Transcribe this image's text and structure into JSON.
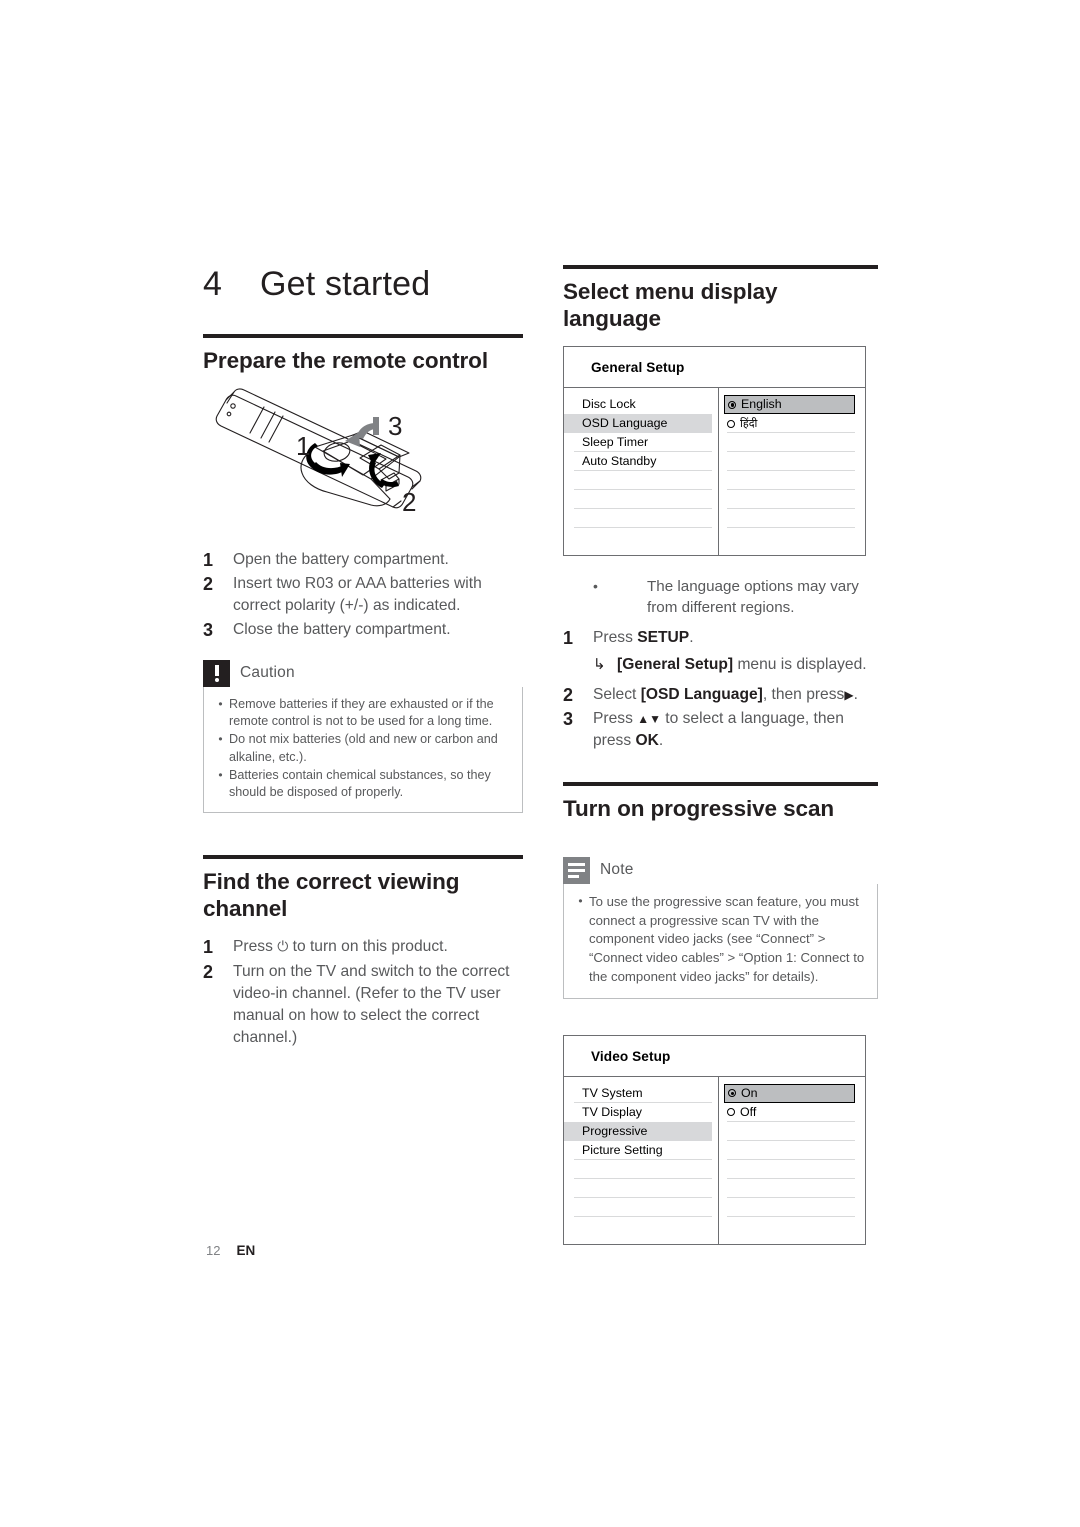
{
  "document": {
    "footer": {
      "page_number": "12",
      "language_code": "EN"
    }
  },
  "chapter": {
    "number": "4",
    "title": "Get started"
  },
  "left_column": {
    "section_remote": {
      "heading": "Prepare the remote control",
      "figure_name": "remote-control-battery-compartment-diagram",
      "figure_callouts": [
        "1",
        "2",
        "3"
      ],
      "steps": [
        {
          "num": "1",
          "text": "Open the battery compartment."
        },
        {
          "num": "2",
          "text": "Insert two R03 or AAA batteries with correct polarity (+/-) as indicated."
        },
        {
          "num": "3",
          "text": "Close the battery compartment."
        }
      ],
      "caution": {
        "title": "Caution",
        "bullets": [
          "Remove batteries if they are exhausted or if the remote control is not to be used for a long time.",
          "Do not mix batteries (old and new or carbon and alkaline, etc.).",
          "Batteries contain chemical substances, so they should be disposed of properly."
        ]
      }
    },
    "section_channel": {
      "heading": "Find the correct viewing channel",
      "steps": [
        {
          "num": "1",
          "text_before": "Press ",
          "symbol": "⏻",
          "text_after": " to turn on this product."
        },
        {
          "num": "2",
          "text": "Turn on the TV and switch to the correct video-in channel. (Refer to the TV user manual on how to select the correct channel.)"
        }
      ]
    }
  },
  "right_column": {
    "section_language": {
      "heading": "Select menu display language",
      "osd": {
        "title": "General Setup",
        "left_items": [
          {
            "label": "Disc Lock",
            "selected": false
          },
          {
            "label": "OSD Language",
            "selected": true
          },
          {
            "label": "Sleep Timer",
            "selected": false
          },
          {
            "label": "Auto Standby",
            "selected": false
          }
        ],
        "right_items": [
          {
            "label": "English",
            "radio": "on",
            "highlighted": true
          },
          {
            "label": "हिंदी",
            "radio": "off",
            "highlighted": false
          }
        ]
      },
      "note_bullets": [
        "The language options may vary from different regions."
      ],
      "steps": [
        {
          "num": "1",
          "text_before": "Press ",
          "bold": "SETUP",
          "text_after": ".",
          "substep": {
            "arrow": "↳",
            "bold": "[General Setup]",
            "text_after": " menu is displayed."
          }
        },
        {
          "num": "2",
          "text_before": "Select ",
          "bold": "[OSD Language]",
          "text_after": ", then press",
          "symbol": "▶",
          "tail": "."
        },
        {
          "num": "3",
          "text_before": "Press ",
          "symbol": "▲▼",
          "text_after": " to select a language, then press ",
          "bold": "OK",
          "tail": "."
        }
      ]
    },
    "section_progressive": {
      "heading": "Turn on progressive scan",
      "note": {
        "title": "Note",
        "bullets": [
          "To use the progressive scan feature, you must connect a progressive scan TV with the component video jacks (see “Connect” > “Connect video cables” > “Option 1: Connect to the component video jacks” for details)."
        ]
      },
      "osd": {
        "title": "Video Setup",
        "left_items": [
          {
            "label": "TV System",
            "selected": false
          },
          {
            "label": "TV Display",
            "selected": false
          },
          {
            "label": "Progressive",
            "selected": true
          },
          {
            "label": "Picture Setting",
            "selected": false
          }
        ],
        "right_items": [
          {
            "label": "On",
            "radio": "on",
            "highlighted": true
          },
          {
            "label": "Off",
            "radio": "off",
            "highlighted": false
          }
        ]
      }
    }
  },
  "colors": {
    "text_dark": "#231f20",
    "text_body": "#58595b",
    "rule": "#231f20",
    "caution_icon_bg": "#231f20",
    "note_icon_bg": "#808285",
    "osd_border": "#6d6e71",
    "osd_selected_bg": "#d7d8da",
    "osd_highlight_bg": "#bcbec0"
  }
}
